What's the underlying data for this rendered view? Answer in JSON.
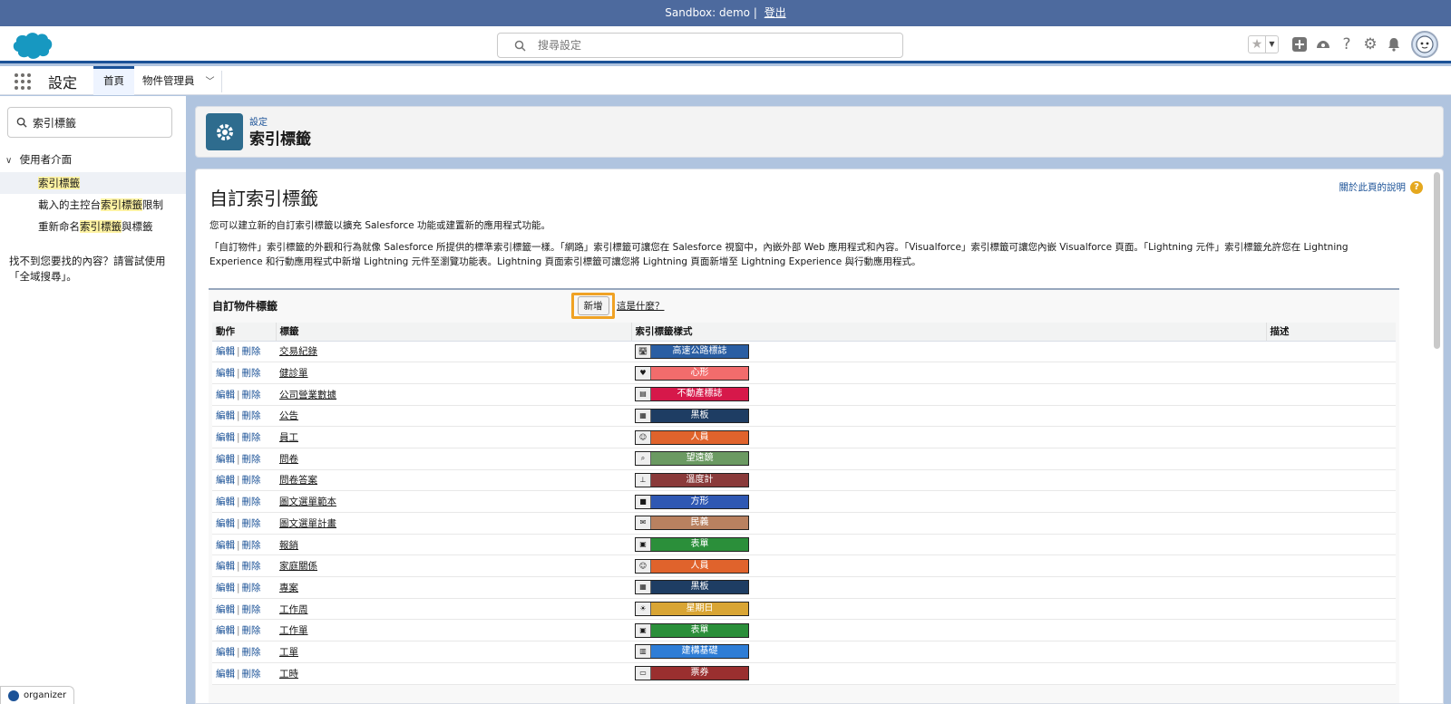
{
  "sandbox": {
    "text": "Sandbox: demo |",
    "logout": "登出"
  },
  "header": {
    "search_placeholder": "搜尋設定",
    "icons": [
      "favorites-star-icon",
      "add-icon",
      "trailhead-icon",
      "help-icon",
      "setup-gear-icon",
      "notification-bell-icon",
      "user-avatar"
    ]
  },
  "context": {
    "app_name": "設定",
    "tabs": [
      {
        "label": "首頁",
        "active": true
      },
      {
        "label": "物件管理員",
        "active": false
      }
    ]
  },
  "sidebar": {
    "search_value": "索引標籤",
    "section": "使用者介面",
    "items": [
      {
        "pre": "",
        "hl": "索引標籤",
        "post": ""
      },
      {
        "pre": "載入的主控台",
        "hl": "索引標籤",
        "post": "限制"
      },
      {
        "pre": "重新命名",
        "hl": "索引標籤",
        "post": "與標籤"
      }
    ],
    "hint": "找不到您要找的內容？請嘗試使用「全域搜尋」。",
    "organizer": "organizer"
  },
  "page_header": {
    "breadcrumb": "設定",
    "title": "索引標籤"
  },
  "content": {
    "title": "自訂索引標籤",
    "help": "關於此頁的說明",
    "intro": "您可以建立新的自訂索引標籤以擴充 Salesforce 功能或建置新的應用程式功能。",
    "description": "「自訂物件」索引標籤的外觀和行為就像 Salesforce 所提供的標準索引標籤一樣。「網路」索引標籤可讓您在 Salesforce 視窗中，內嵌外部 Web 應用程式和內容。「Visualforce」索引標籤可讓您內嵌 Visualforce 頁面。「Lightning 元件」索引標籤允許您在 Lightning Experience 和行動應用程式中新增 Lightning 元件至瀏覽功能表。Lightning 頁面索引標籤可讓您將 Lightning 頁面新增至 Lightning Experience 與行動應用程式。",
    "list_title": "自訂物件標籤",
    "new_button": "新增",
    "what_link": "這是什麼？",
    "columns": [
      "動作",
      "標籤",
      "索引標籤樣式",
      "描述"
    ],
    "edit": "編輯",
    "delete": "刪除",
    "rows": [
      {
        "label": "交易紀錄",
        "style": "高速公路標誌",
        "color": "#2a5ea3",
        "icon": "🛣"
      },
      {
        "label": "健診單",
        "style": "心形",
        "color": "#f26c6c",
        "icon": "♥"
      },
      {
        "label": "公司營業數據",
        "style": "不動產標誌",
        "color": "#d6184a",
        "icon": "▤"
      },
      {
        "label": "公告",
        "style": "黑板",
        "color": "#1e3d63",
        "icon": "▦"
      },
      {
        "label": "員工",
        "style": "人員",
        "color": "#e0632c",
        "icon": "☺"
      },
      {
        "label": "問卷",
        "style": "望遠鏡",
        "color": "#6b9a62",
        "icon": "⌕"
      },
      {
        "label": "問卷答案",
        "style": "溫度計",
        "color": "#8a3a3a",
        "icon": "⊥"
      },
      {
        "label": "圖文選單範本",
        "style": "方形",
        "color": "#2f58b3",
        "icon": "■"
      },
      {
        "label": "圖文選單計畫",
        "style": "民義",
        "color": "#b98160",
        "icon": "✉"
      },
      {
        "label": "報銷",
        "style": "表單",
        "color": "#2b8f3a",
        "icon": "▣"
      },
      {
        "label": "家庭關係",
        "style": "人員",
        "color": "#e0632c",
        "icon": "☺"
      },
      {
        "label": "專案",
        "style": "黑板",
        "color": "#1e3d63",
        "icon": "▦"
      },
      {
        "label": "工作周",
        "style": "星期日",
        "color": "#d9a534",
        "icon": "☀"
      },
      {
        "label": "工作單",
        "style": "表單",
        "color": "#2b8f3a",
        "icon": "▣"
      },
      {
        "label": "工單",
        "style": "建構基礎",
        "color": "#2e7dd6",
        "icon": "▥"
      },
      {
        "label": "工時",
        "style": "票券",
        "color": "#9a2f2f",
        "icon": "▭"
      }
    ]
  },
  "colors": {
    "brand": "#1b5297",
    "highlight": "#f0a224",
    "banner": "#4d6a9e"
  }
}
